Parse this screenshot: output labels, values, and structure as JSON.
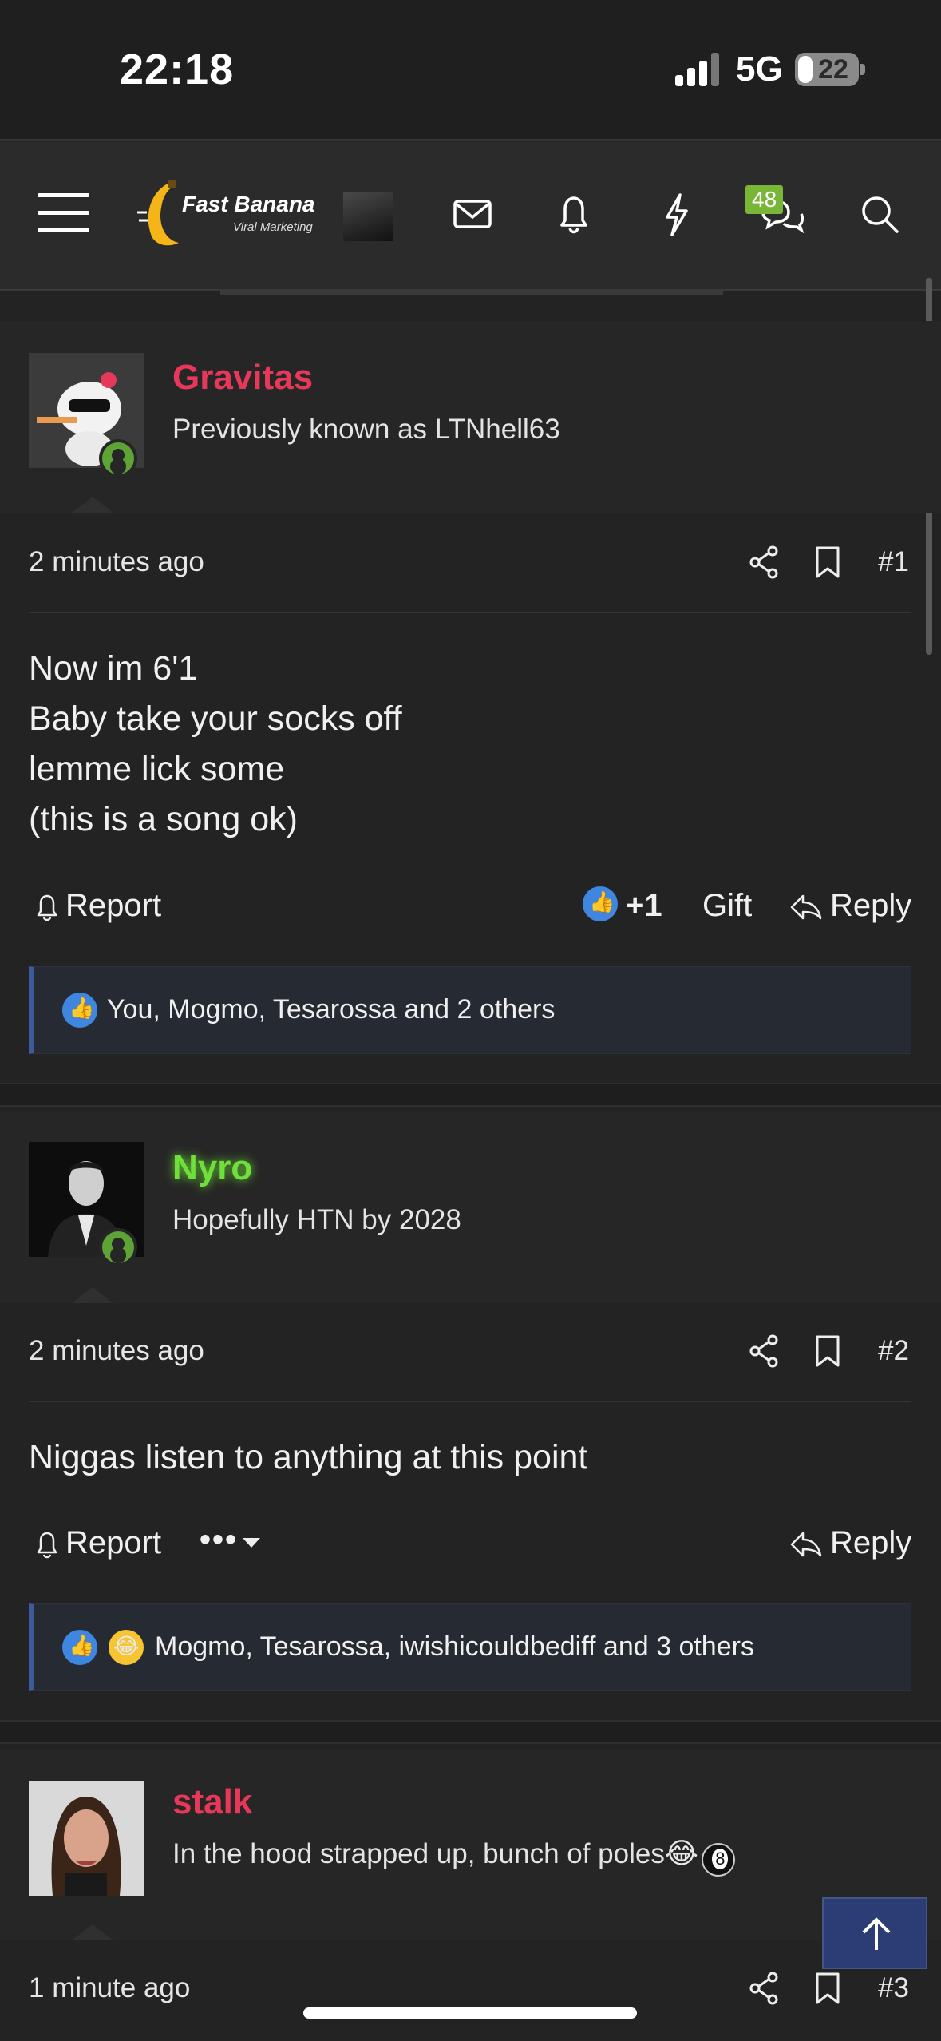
{
  "status_bar": {
    "time": "22:18",
    "network": "5G",
    "battery": "22"
  },
  "header": {
    "logo_title": "Fast Banana",
    "logo_subtitle": "Viral Marketing",
    "conversations_badge": "48",
    "icons": [
      "menu-icon",
      "mail-icon",
      "bell-icon",
      "lightning-icon",
      "chat-icon",
      "search-icon"
    ]
  },
  "posts": [
    {
      "username": "Gravitas",
      "user_title": "Previously known as LTNhell63",
      "time": "2 minutes ago",
      "number": "#1",
      "body": [
        "Now im 6'1",
        "Baby take your socks off",
        "lemme lick some",
        "(this is a song ok)"
      ],
      "report_label": "Report",
      "reaction_count": "+1",
      "gift_label": "Gift",
      "reply_label": "Reply",
      "reactions_text": "You, Mogmo, Tesarossa and 2 others"
    },
    {
      "username": "Nyro",
      "user_title": "Hopefully HTN by 2028",
      "time": "2 minutes ago",
      "number": "#2",
      "body": [
        "Niggas listen to anything at this point"
      ],
      "report_label": "Report",
      "more_label": "•••",
      "reply_label": "Reply",
      "reactions_text": "Mogmo, Tesarossa, iwishicouldbediff and 3 others"
    },
    {
      "username": "stalk",
      "user_title": "In the hood strapped up, bunch of poles",
      "user_title_emoji": "😂",
      "time": "1 minute ago",
      "number": "#3"
    }
  ],
  "colors": {
    "username_red": "#e8385a",
    "username_green": "#6fe03a",
    "badge_green": "#79b537",
    "like_blue": "#3f86e0",
    "accent_navy": "#2c3d75"
  }
}
